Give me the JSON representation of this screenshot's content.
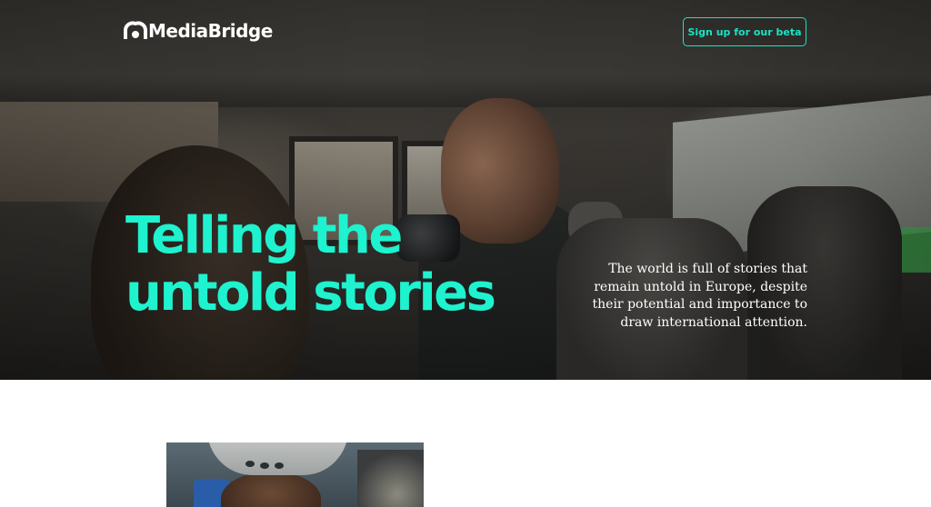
{
  "header": {
    "logo_text": "MediaBridge",
    "cta_label": "Sign up for our beta"
  },
  "hero": {
    "headline_line1": "Telling the",
    "headline_line2": "untold stories",
    "description": "The world is full of stories that remain untold in Europe, despite their potential and importance to draw international attention."
  },
  "colors": {
    "accent": "#1ef2cf",
    "button_border": "#19e3c4",
    "text_light": "#ffffff",
    "page_background": "#ffffff"
  },
  "icons": {
    "logo_mark": "mediabridge-logo-icon"
  }
}
